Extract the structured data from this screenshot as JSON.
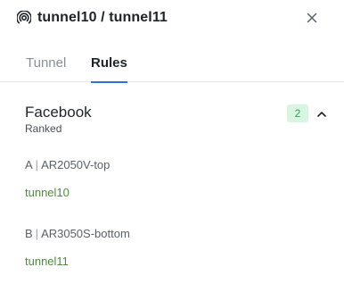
{
  "header": {
    "title": "tunnel10 / tunnel11",
    "icon": "broadcast-icon",
    "close_icon": "close-icon"
  },
  "tabs": [
    {
      "label": "Tunnel",
      "active": false
    },
    {
      "label": "Rules",
      "active": true
    }
  ],
  "group": {
    "title": "Facebook",
    "subtitle": "Ranked",
    "count": "2",
    "badge_bg": "#d8f5e2",
    "badge_fg": "#2e9d57"
  },
  "rules": [
    {
      "letter": "A",
      "separator": "|",
      "device": "AR2050V-top",
      "tunnel": "tunnel10"
    },
    {
      "letter": "B",
      "separator": "|",
      "device": "AR3050S-bottom",
      "tunnel": "tunnel11"
    }
  ],
  "colors": {
    "accent": "#2f6fe0",
    "link": "#4f8a3c"
  }
}
